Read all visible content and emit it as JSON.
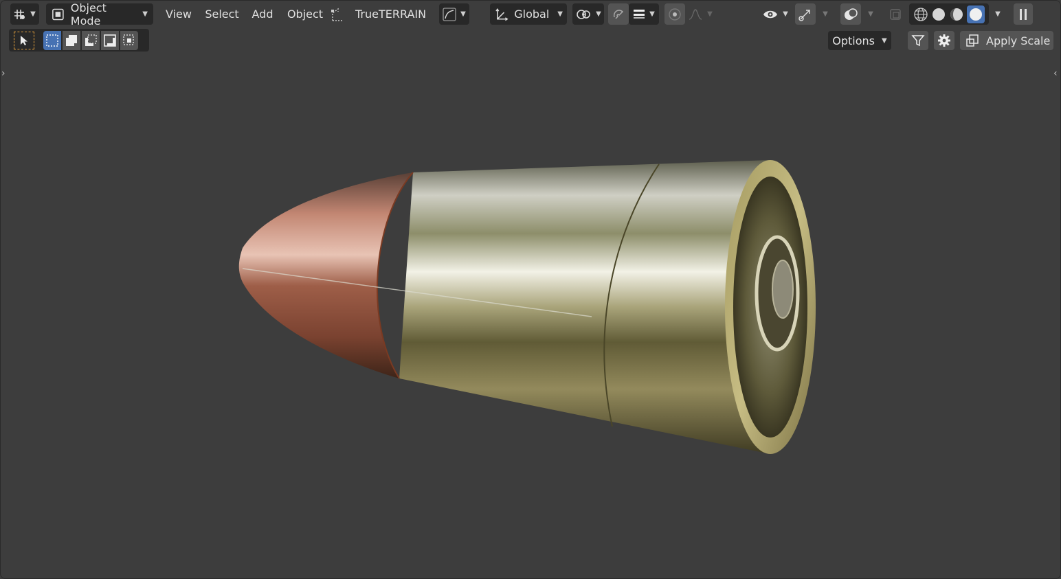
{
  "header": {
    "mode_label": "Object Mode",
    "menus": {
      "view": "View",
      "select": "Select",
      "add": "Add",
      "object": "Object"
    },
    "addon_label": "TrueTERRAIN",
    "orientation_label": "Global"
  },
  "toolbar2": {
    "options_label": "Options",
    "apply_scale_label": "Apply Scale"
  },
  "icons": {
    "editor_type": "editor-type-icon",
    "object_mode": "object-mode-icon",
    "transform_orientation": "orientation-icon",
    "pivot": "pivot-icon",
    "snap": "snap-magnet-icon",
    "proportional": "proportional-edit-icon",
    "visibility": "eye-icon",
    "gizmo": "gizmo-icon",
    "overlay": "overlay-icon",
    "xray": "xray-icon",
    "shading_wireframe": "wireframe-shading-icon",
    "shading_solid": "solid-shading-icon",
    "shading_material": "material-shading-icon",
    "shading_rendered": "rendered-shading-icon",
    "pause": "pause-icon",
    "filter": "filter-icon",
    "settings": "gear-icon"
  },
  "colors": {
    "background": "#3d3d3d",
    "header_button": "#282828",
    "active_accent": "#4772b3",
    "select_box_highlight": "#e8a33c"
  },
  "viewport": {
    "object": "bullet-cartridge"
  }
}
